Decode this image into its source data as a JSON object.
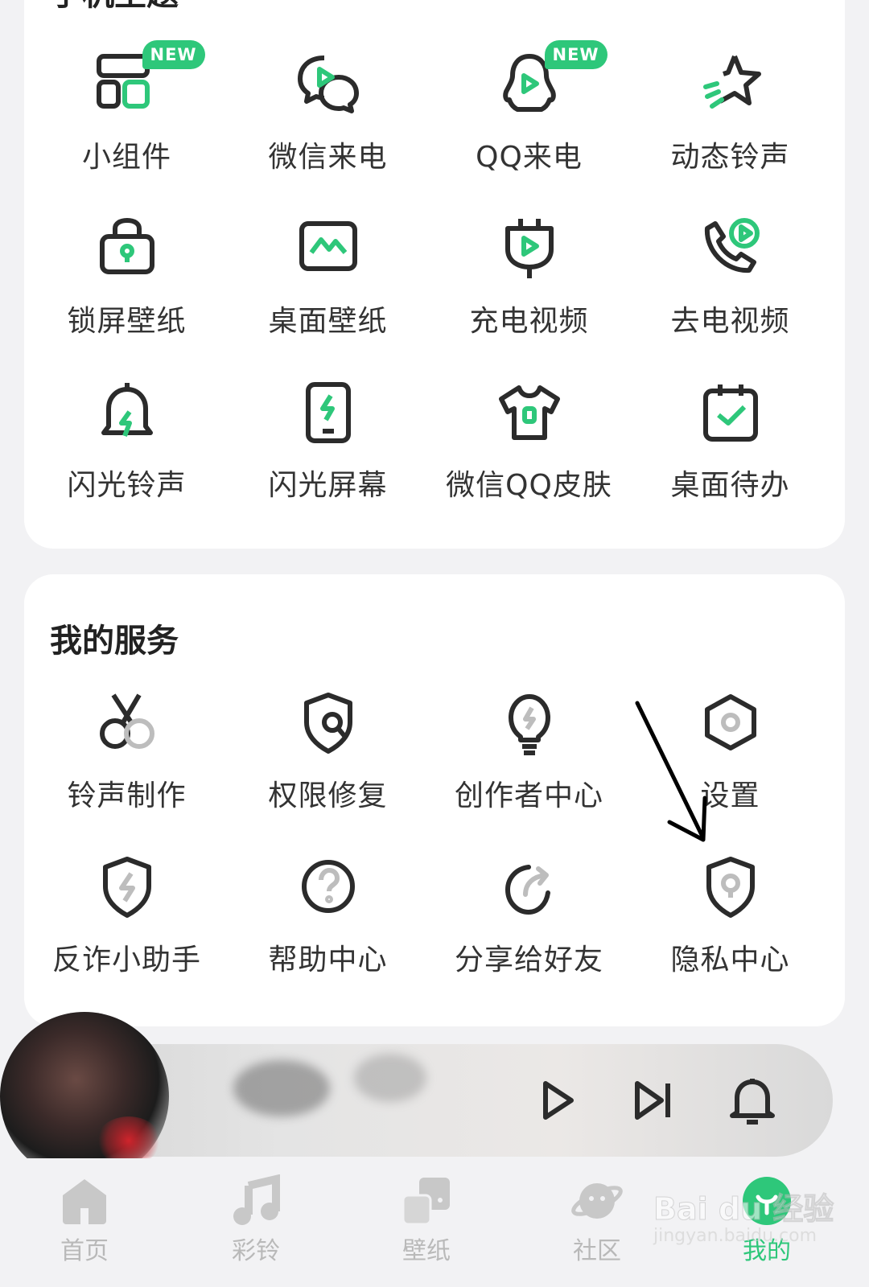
{
  "theme_section": {
    "title": "手机主题",
    "items": [
      {
        "label": "小组件",
        "icon": "widget-icon",
        "badge": "NEW"
      },
      {
        "label": "微信来电",
        "icon": "wechat-call-icon"
      },
      {
        "label": "QQ来电",
        "icon": "qq-call-icon",
        "badge": "NEW"
      },
      {
        "label": "动态铃声",
        "icon": "dynamic-ringtone-icon"
      },
      {
        "label": "锁屏壁纸",
        "icon": "lockscreen-wallpaper-icon"
      },
      {
        "label": "桌面壁纸",
        "icon": "desktop-wallpaper-icon"
      },
      {
        "label": "充电视频",
        "icon": "charging-video-icon"
      },
      {
        "label": "去电视频",
        "icon": "outgoing-call-video-icon"
      },
      {
        "label": "闪光铃声",
        "icon": "flash-ringtone-icon"
      },
      {
        "label": "闪光屏幕",
        "icon": "flash-screen-icon"
      },
      {
        "label": "微信QQ皮肤",
        "icon": "wechat-qq-skin-icon"
      },
      {
        "label": "桌面待办",
        "icon": "desktop-todo-icon"
      }
    ]
  },
  "services_section": {
    "title": "我的服务",
    "items": [
      {
        "label": "铃声制作",
        "icon": "ringtone-maker-icon"
      },
      {
        "label": "权限修复",
        "icon": "permission-repair-icon"
      },
      {
        "label": "创作者中心",
        "icon": "creator-center-icon"
      },
      {
        "label": "设置",
        "icon": "settings-icon"
      },
      {
        "label": "反诈小助手",
        "icon": "anti-fraud-icon"
      },
      {
        "label": "帮助中心",
        "icon": "help-center-icon"
      },
      {
        "label": "分享给好友",
        "icon": "share-icon"
      },
      {
        "label": "隐私中心",
        "icon": "privacy-center-icon"
      }
    ]
  },
  "player": {
    "controls": [
      "play-icon",
      "skip-next-icon",
      "bell-icon"
    ]
  },
  "bottom_nav": {
    "items": [
      {
        "label": "首页",
        "icon": "home-icon"
      },
      {
        "label": "彩铃",
        "icon": "music-note-icon"
      },
      {
        "label": "壁纸",
        "icon": "wallpaper-icon"
      },
      {
        "label": "社区",
        "icon": "planet-icon"
      },
      {
        "label": "我的",
        "icon": "profile-icon",
        "active": true
      }
    ]
  },
  "watermark": {
    "main": "Bai du 经验",
    "url": "jingyan.baidu.com"
  },
  "colors": {
    "accent": "#2ec77a",
    "icon_stroke": "#2b2b2b",
    "nav_inactive": "#b9b9b9",
    "card_bg": "#ffffff",
    "page_bg": "#f2f2f4"
  }
}
